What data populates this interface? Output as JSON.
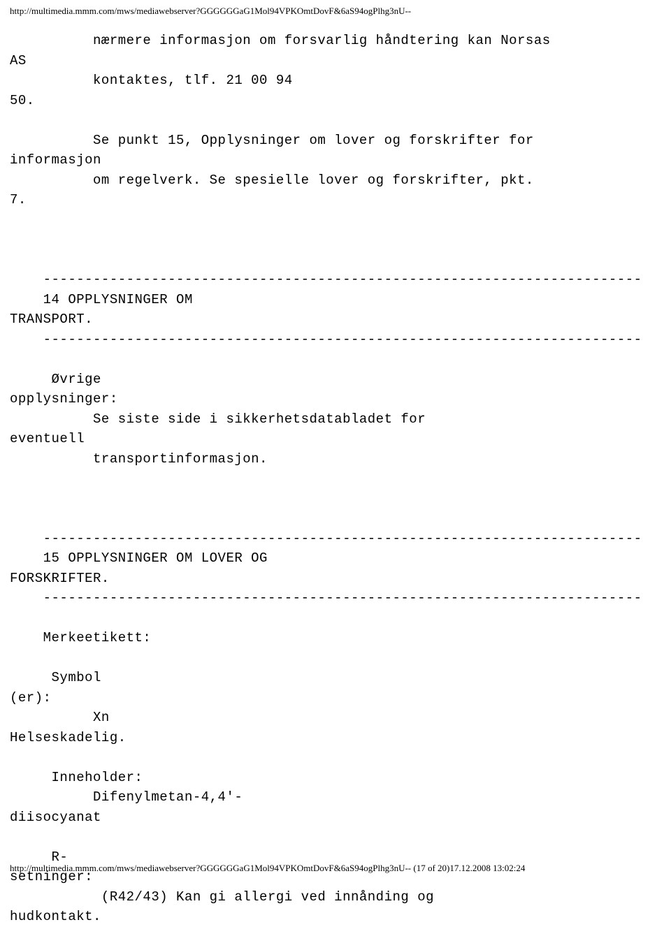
{
  "header": {
    "url": "http://multimedia.mmm.com/mws/mediawebserver?GGGGGGaG1Mol94VPKOmtDovF&6aS94ogPlhg3nU--"
  },
  "body": {
    "line1": "          nærmere informasjon om forsvarlig håndtering kan Norsas ",
    "line2": "AS ",
    "line3": "          kontaktes, tlf. 21 00 94 ",
    "line4": "50. ",
    "line5": " ",
    "line6": "          Se punkt 15, Opplysninger om lover og forskrifter for ",
    "line7": "informasjon ",
    "line8": "          om regelverk. Se spesielle lover og forskrifter, pkt. ",
    "line9": "7.",
    "line10": " ",
    "line11": " ",
    "line12": " ",
    "line13": "    ------------------------------------------------------------------------",
    "line14": "    14 OPPLYSNINGER OM ",
    "line15": "TRANSPORT.",
    "line16": "    ------------------------------------------------------------------------",
    "line17": " ",
    "line18": "     Øvrige ",
    "line19": "opplysninger:",
    "line20": "          Se siste side i sikkerhetsdatabladet for ",
    "line21": "eventuell ",
    "line22": "          transportinformasjon.",
    "line23": " ",
    "line24": " ",
    "line25": " ",
    "line26": "    ------------------------------------------------------------------------",
    "line27": "    15 OPPLYSNINGER OM LOVER OG ",
    "line28": "FORSKRIFTER.",
    "line29": "    ------------------------------------------------------------------------",
    "line30": " ",
    "line31": "    Merkeetikett:",
    "line32": " ",
    "line33": "     Symbol",
    "line34": "(er):",
    "line35": "          Xn    ",
    "line36": "Helseskadelig.",
    "line37": " ",
    "line38": "     Inneholder:     ",
    "line39": "          Difenylmetan-4,4'-",
    "line40": "diisocyanat",
    "line41": " ",
    "line42": "     R-",
    "line43": "setninger:",
    "line44": "           (R42/43) Kan gi allergi ved innånding og ",
    "line45": "hudkontakt."
  },
  "footer": {
    "url": "http://multimedia.mmm.com/mws/mediawebserver?GGGGGGaG1Mol94VPKOmtDovF&6aS94ogPlhg3nU-- (17 of 20)17.12.2008 13:02:24"
  }
}
